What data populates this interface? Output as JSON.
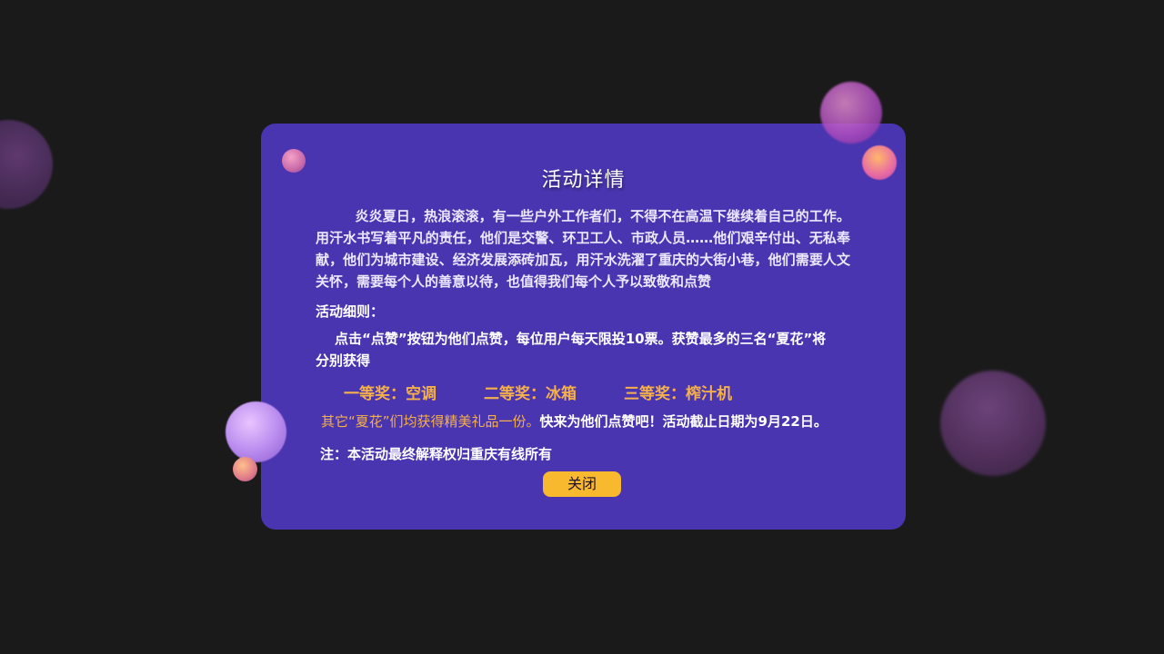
{
  "dialog": {
    "title": "活动详情",
    "intro": "炎炎夏日，热浪滚滚，有一些户外工作者们，不得不在高温下继续着自己的工作。用汗水书写着平凡的责任，他们是交警、环卫工人、市政人员……他们艰辛付出、无私奉献，他们为城市建设、经济发展添砖加瓦，用汗水洗濯了重庆的大街小巷，他们需要人文关怀，需要每个人的善意以待，也值得我们每个人予以致敬和点赞",
    "rules_heading": "活动细则：",
    "rules_body": "点击“点赞”按钮为他们点赞，每位用户每天限投10票。获赞最多的三名“夏花”将分别获得",
    "prizes": [
      "一等奖：空调",
      "二等奖：冰箱",
      "三等奖：榨汁机"
    ],
    "other_gift": "其它“夏花”们均获得精美礼品一份。",
    "call_to_action": "快来为他们点赞吧！活动截止日期为9月22日。",
    "note": "注：本活动最终解释权归重庆有线所有",
    "close_label": "关闭"
  },
  "colors": {
    "background": "#1a1a1a",
    "dialog": "#4a35b0",
    "highlight": "#f5b04a",
    "button": "#f9b92e"
  }
}
